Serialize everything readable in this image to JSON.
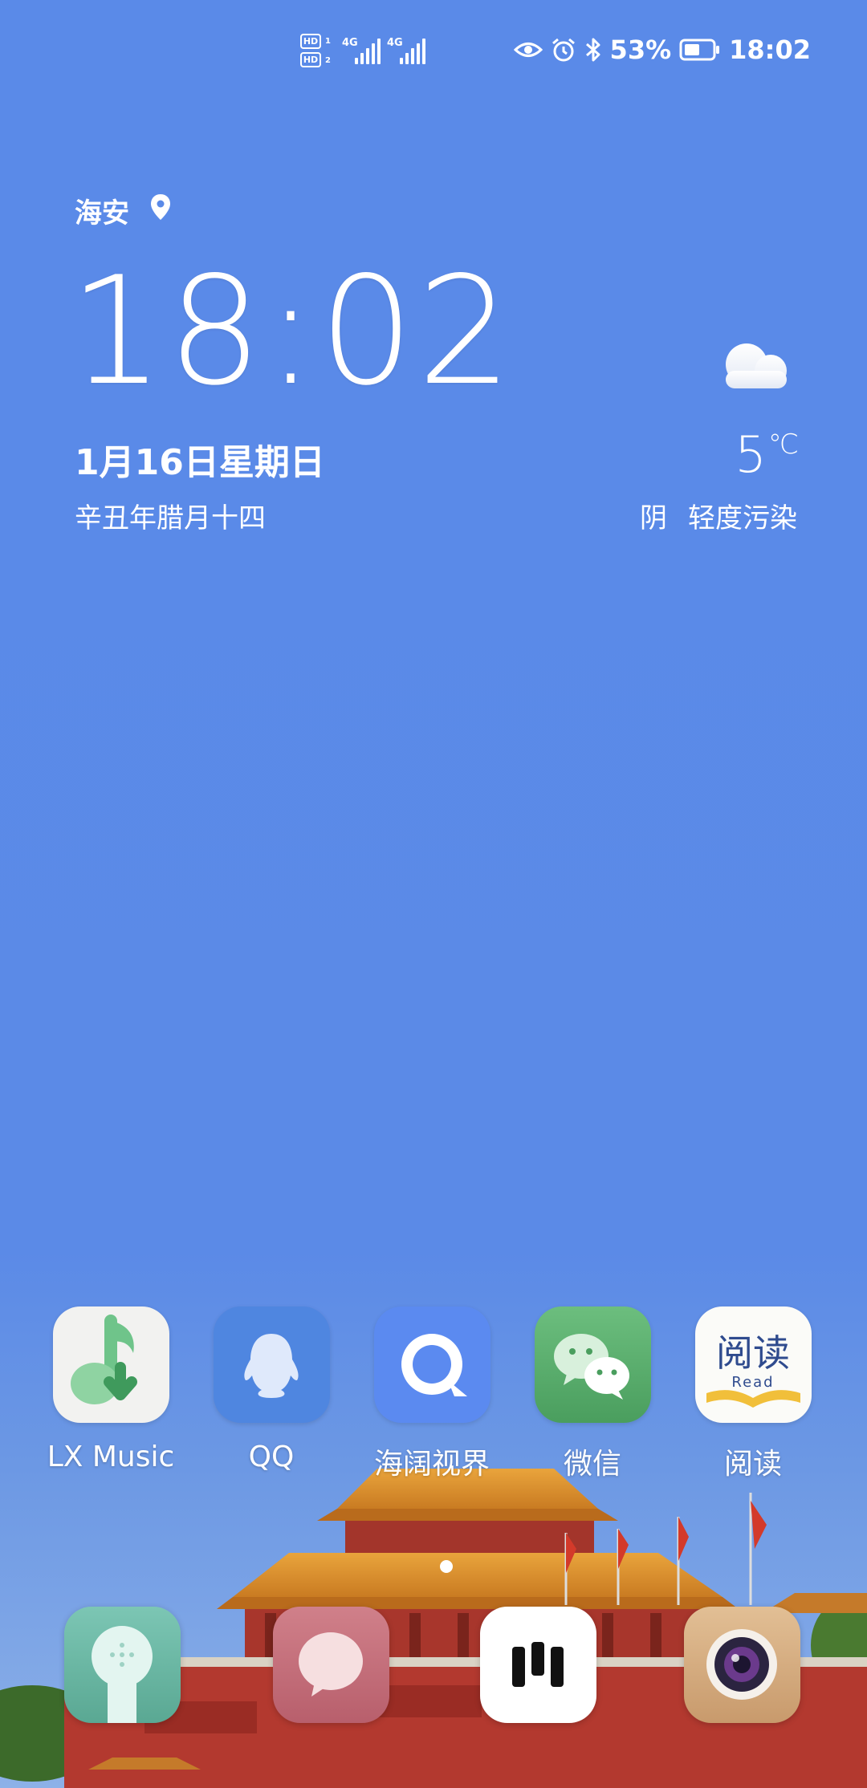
{
  "status_bar": {
    "sim1_badge": "HD",
    "sim1_index": "1",
    "sim2_badge": "HD",
    "sim2_index": "2",
    "sim1_network": "4G",
    "sim2_network": "4G",
    "battery_percent": "53%",
    "time": "18:02",
    "icons": [
      "eye-comfort-icon",
      "alarm-icon",
      "bluetooth-icon",
      "battery-icon"
    ]
  },
  "widget": {
    "location": "海安",
    "time": "18:02",
    "date": "1月16日星期日",
    "lunar_date": "辛丑年腊月十四",
    "temperature": "5",
    "temperature_unit": "℃",
    "condition": "阴",
    "air_quality": "轻度污染",
    "weather_icon": "cloud-icon"
  },
  "apps": [
    {
      "label": "LX Music",
      "icon": "lx-music-icon"
    },
    {
      "label": "QQ",
      "icon": "qq-penguin-icon"
    },
    {
      "label": "海阔视界",
      "icon": "search-bubble-icon"
    },
    {
      "label": "微信",
      "icon": "wechat-icon"
    },
    {
      "label": "阅读",
      "icon": "read-book-icon",
      "icon_text": "阅读",
      "icon_subtext": "Read"
    }
  ],
  "dock": [
    {
      "icon": "phone-icon"
    },
    {
      "icon": "messages-icon"
    },
    {
      "icon": "browser-icon"
    },
    {
      "icon": "camera-icon"
    }
  ],
  "colors": {
    "sky": "#5a8ae8",
    "accent_green": "#5cb67a",
    "wechat_green": "#4fa463"
  }
}
